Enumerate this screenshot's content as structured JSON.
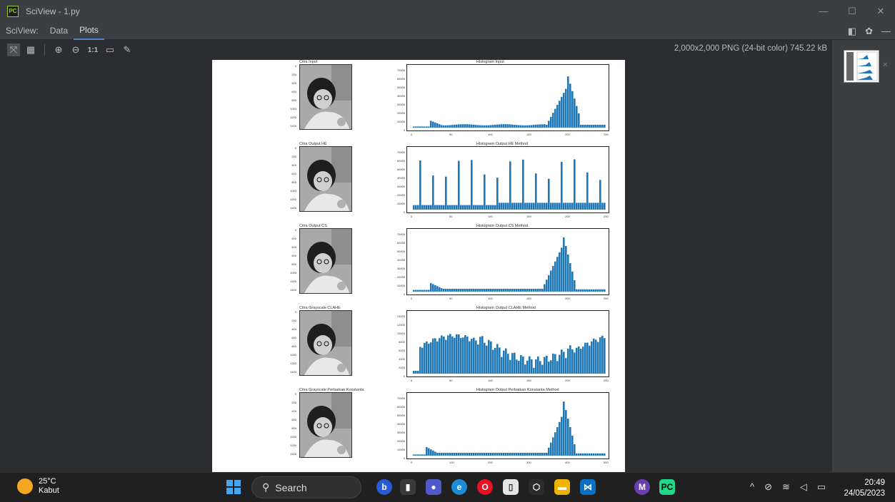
{
  "window": {
    "logo": "PC",
    "title": "SciView - 1.py",
    "controls": [
      "—",
      "☐",
      "✕"
    ]
  },
  "tabs": {
    "prefix": "SciView:",
    "items": [
      {
        "label": "Data",
        "active": false
      },
      {
        "label": "Plots",
        "active": true
      }
    ]
  },
  "toolbar": {
    "icons": [
      "fit-icon",
      "grid-icon",
      "zoom-in-icon",
      "zoom-out-icon",
      "actual-size-icon",
      "background-icon",
      "color-picker-icon"
    ],
    "actual_size_label": "1:1"
  },
  "image_info": "2,000x2,000 PNG (24-bit color) 745.22 kB",
  "plots": [
    {
      "img_title": "Citra Input",
      "hist_title": "Histogram Input",
      "y_ticks": [
        "0",
        "200",
        "400",
        "600",
        "800",
        "1000",
        "1200",
        "1400"
      ],
      "hist_y_ticks": [
        "0",
        "10000",
        "20000",
        "30000",
        "40000",
        "50000",
        "60000",
        "70000"
      ],
      "hist_x_ticks": [
        "0",
        "50",
        "100",
        "150",
        "200",
        "250"
      ]
    },
    {
      "img_title": "Citra Output HE",
      "hist_title": "Histogram Output HE Method",
      "y_ticks": [
        "0",
        "200",
        "400",
        "600",
        "800",
        "1000",
        "1200",
        "1400"
      ],
      "hist_y_ticks": [
        "0",
        "10000",
        "20000",
        "30000",
        "40000",
        "50000",
        "60000",
        "70000"
      ],
      "hist_x_ticks": [
        "0",
        "50",
        "100",
        "150",
        "200",
        "250"
      ]
    },
    {
      "img_title": "Citra Output CS",
      "hist_title": "Histogram Output CS Method",
      "y_ticks": [
        "0",
        "200",
        "400",
        "600",
        "800",
        "1000",
        "1200",
        "1400"
      ],
      "hist_y_ticks": [
        "0",
        "10000",
        "20000",
        "30000",
        "40000",
        "50000",
        "60000",
        "70000"
      ],
      "hist_x_ticks": [
        "0",
        "50",
        "100",
        "150",
        "200",
        "250"
      ]
    },
    {
      "img_title": "Citra Grayscale CLAHE",
      "hist_title": "Histogram Output CLAHE Method",
      "y_ticks": [
        "0",
        "200",
        "400",
        "600",
        "800",
        "1000",
        "1200",
        "1400"
      ],
      "hist_y_ticks": [
        "0",
        "2000",
        "4000",
        "6000",
        "8000",
        "10000",
        "12000",
        "14000"
      ],
      "hist_x_ticks": [
        "0",
        "50",
        "100",
        "150",
        "200",
        "250"
      ]
    },
    {
      "img_title": "Citra Grayscale Perbaikan Konstanta",
      "hist_title": "Histogram Output Perbaikan Konstanta Method",
      "y_ticks": [
        "0",
        "200",
        "400",
        "600",
        "800",
        "1000",
        "1200",
        "1400"
      ],
      "hist_y_ticks": [
        "0",
        "10000",
        "20000",
        "30000",
        "40000",
        "50000",
        "60000",
        "70000"
      ],
      "hist_x_ticks": [
        "0",
        "100",
        "200",
        "300",
        "400",
        "500"
      ]
    }
  ],
  "taskbar": {
    "weather_temp": "25°C",
    "weather_desc": "Kabut",
    "search_label": "Search",
    "time": "20:49",
    "date": "24/05/2023",
    "hist_color": "#1f77b4"
  }
}
